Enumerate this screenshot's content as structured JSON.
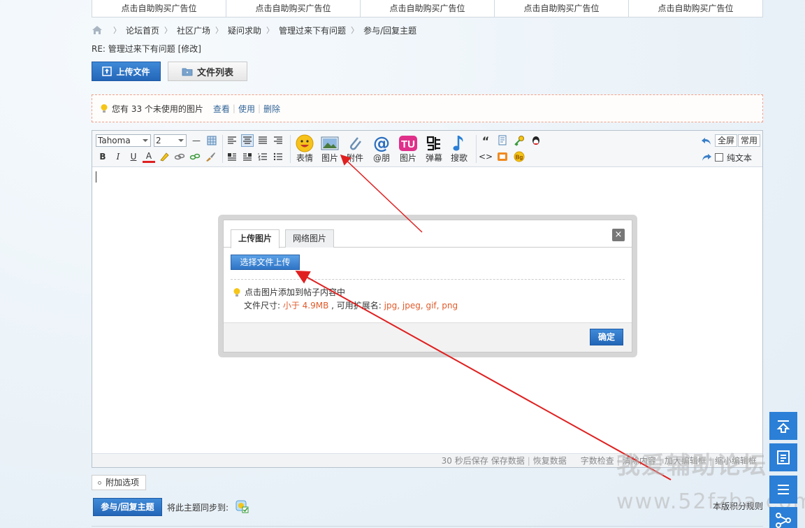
{
  "ads": [
    "点击自助购买广告位",
    "点击自助购买广告位",
    "点击自助购买广告位",
    "点击自助购买广告位",
    "点击自助购买广告位"
  ],
  "breadcrumb": [
    "论坛首页",
    "社区广场",
    "疑问求助",
    "管理过来下有问题",
    "参与/回复主题"
  ],
  "reply_title": "RE: 管理过来下有问题 [修改]",
  "upload_tabs": {
    "upload": "上传文件",
    "filelist": "文件列表"
  },
  "notice": {
    "text": "您有 33 个未使用的图片",
    "view": "查看",
    "use": "使用",
    "delete": "删除"
  },
  "toolbar": {
    "font": "Tahoma",
    "size": "2",
    "bold": "B",
    "italic": "I",
    "underline": "U",
    "color": "A",
    "buttons": [
      "表情",
      "图片",
      "附件",
      "@朋",
      "图片",
      "弹幕",
      "搜歌"
    ],
    "fullscreen": "全屏",
    "common": "常用",
    "plain_text": "纯文本",
    "quote": "“",
    "code": "<>"
  },
  "status_bar": {
    "autosave": "30 秒后保存",
    "save": "保存数据",
    "restore": "恢复数据",
    "check": "字数检查",
    "clear": "清除内容",
    "enlarge": "加大编辑框",
    "shrink": "缩小编辑框"
  },
  "dialog": {
    "tab_upload": "上传图片",
    "tab_network": "网络图片",
    "close": "×",
    "choose": "选择文件上传",
    "tip1": "点击图片添加到帖子内容中",
    "tip2_prefix": "文件尺寸: ",
    "tip2_size": "小于 4.9MB",
    "tip2_mid": " , 可用扩展名: ",
    "tip2_ext": "jpg, jpeg, gif, png",
    "ok": "确定"
  },
  "bottom": {
    "attach": "附加选项",
    "submit": "参与/回复主题",
    "sync": "将此主题同步到:",
    "rules": "本版积分规则"
  },
  "watermark": {
    "line1": "我爱辅助论坛",
    "line2": "www.52fzba.com"
  },
  "colors": {
    "accent": "#2366b8",
    "link": "#336699",
    "highlight": "#e05b2b",
    "sidebar": "#2b7fd6",
    "arrow": "#e02020"
  }
}
